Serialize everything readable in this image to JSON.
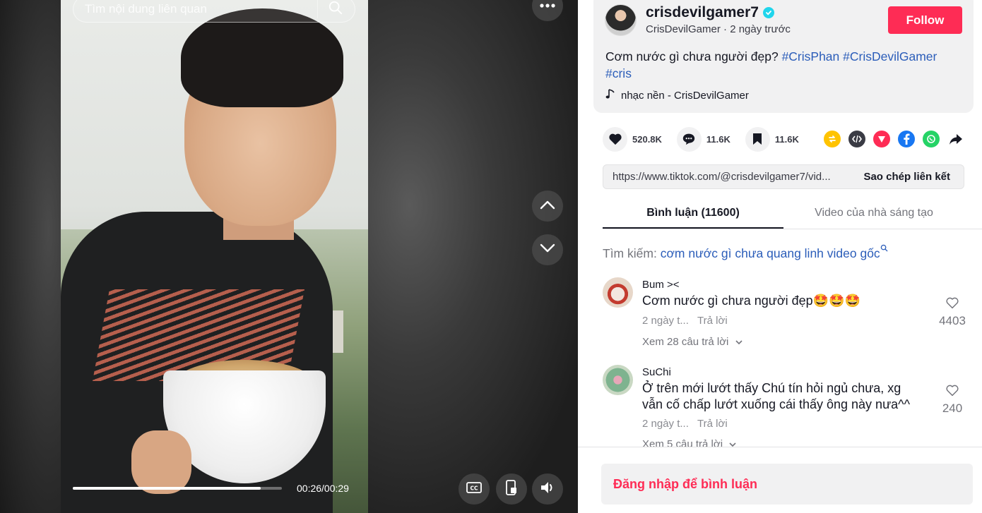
{
  "video": {
    "search_placeholder": "Tìm nội dung liên quan",
    "time": "00:26/00:29",
    "progress_fraction": 0.9
  },
  "post": {
    "username": "crisdevilgamer7",
    "display_name": "CrisDevilGamer",
    "posted": "2 ngày trước",
    "follow_label": "Follow",
    "caption_text": "Cơm nước gì chưa người đẹp?",
    "hashtags": [
      "#CrisPhan",
      "#CrisDevilGamer",
      "#cris"
    ],
    "music": "nhạc nền - CrisDevilGamer"
  },
  "actions": {
    "likes": "520.8K",
    "comments": "11.6K",
    "saves": "11.6K"
  },
  "share_icons": [
    "repost-icon",
    "embed-icon",
    "send-icon",
    "facebook-icon",
    "whatsapp-icon",
    "share-arrow-icon"
  ],
  "link": {
    "url": "https://www.tiktok.com/@crisdevilgamer7/vid...",
    "copy_label": "Sao chép liên kết"
  },
  "tabs": [
    {
      "label": "Bình luận (11600)",
      "active": true
    },
    {
      "label": "Video của nhà sáng tạo",
      "active": false
    }
  ],
  "related_search": {
    "prefix": "Tìm kiếm:",
    "query": "cơm nước gì chưa quang linh video gốc"
  },
  "comments": [
    {
      "author": "Bum ><",
      "text": "Cơm nước gì chưa người đẹp🤩🤩🤩",
      "time": "2 ngày t...",
      "reply_label": "Trả lời",
      "likes": "4403",
      "more_replies": "Xem 28 câu trả lời"
    },
    {
      "author": "SuChi",
      "text": "Ở trên mới lướt thấy Chú tín hỏi ngủ chưa, xg vẫn cố chấp lướt xuống cái thấy ông này nưa^^",
      "time": "2 ngày t...",
      "reply_label": "Trả lời",
      "likes": "240",
      "more_replies": "Xem 5 câu trả lời"
    }
  ],
  "login_prompt": "Đăng nhập để bình luận",
  "colors": {
    "brand": "#fe2c55",
    "hashtag": "#2b5db9",
    "verified": "#20d5ec"
  }
}
